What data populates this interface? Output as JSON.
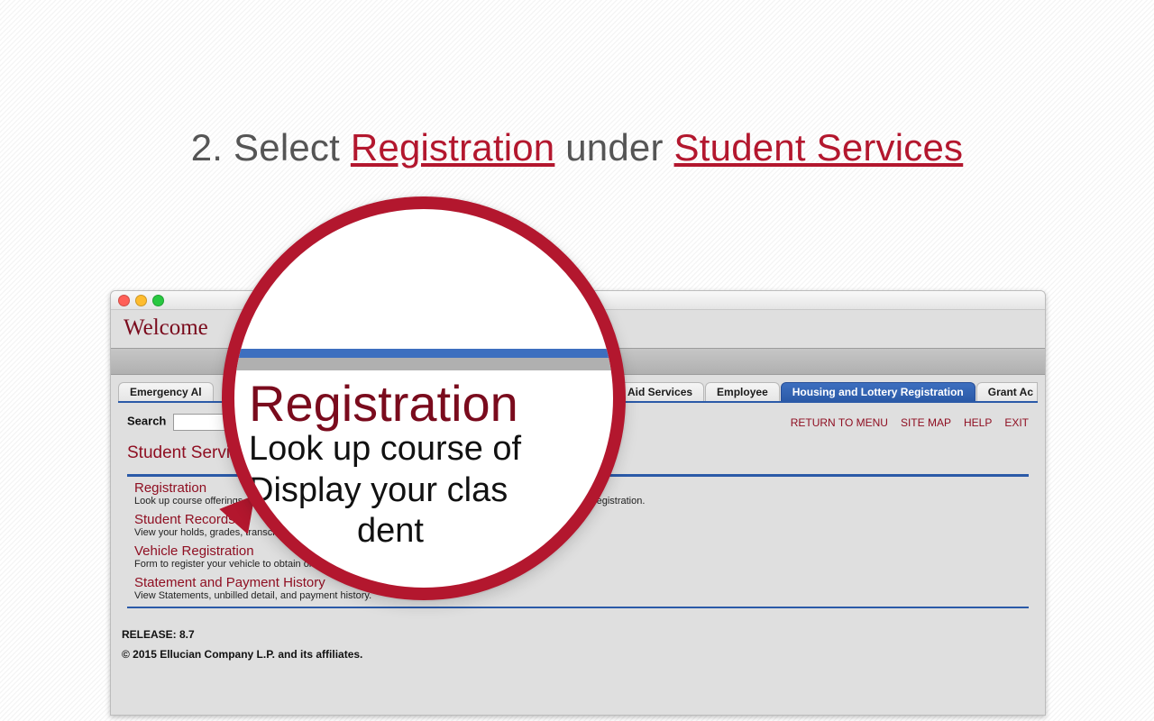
{
  "instruction": {
    "prefix": "2. Select ",
    "link1": "Registration",
    "mid": " under ",
    "link2": "Student Services"
  },
  "window": {
    "welcome": "Welcome",
    "tabs": {
      "t0": "Emergency Al",
      "t1": "cial Aid Services",
      "t2": "Employee",
      "t3": "Housing and Lottery Registration",
      "t4": "Grant Ac"
    },
    "search_label": "Search",
    "util": {
      "return_menu": "RETURN TO MENU",
      "site_map": "SITE MAP",
      "help": "HELP",
      "exit": "EXIT"
    },
    "category_title": "Student Services",
    "items": {
      "reg_title": "Registration",
      "reg_desc_left": "Look up course offerings. Ch",
      "reg_desc_right": "onfirm your Registration.",
      "rec_title": "Student Records",
      "rec_desc": "View your holds, grades, transcripts,",
      "veh_title": "Vehicle Registration",
      "veh_desc": "Form to register your vehicle to obtain on campus parking privileges",
      "stmt_title": "Statement and Payment History",
      "stmt_desc": "View Statements, unbilled detail, and payment history."
    },
    "release": "RELEASE: 8.7",
    "copyright": "© 2015 Ellucian Company L.P. and its affiliates."
  },
  "magnifier": {
    "heading": "Registration",
    "line1": "Look up course of",
    "line2": "Display your clas",
    "line3": "dent"
  }
}
